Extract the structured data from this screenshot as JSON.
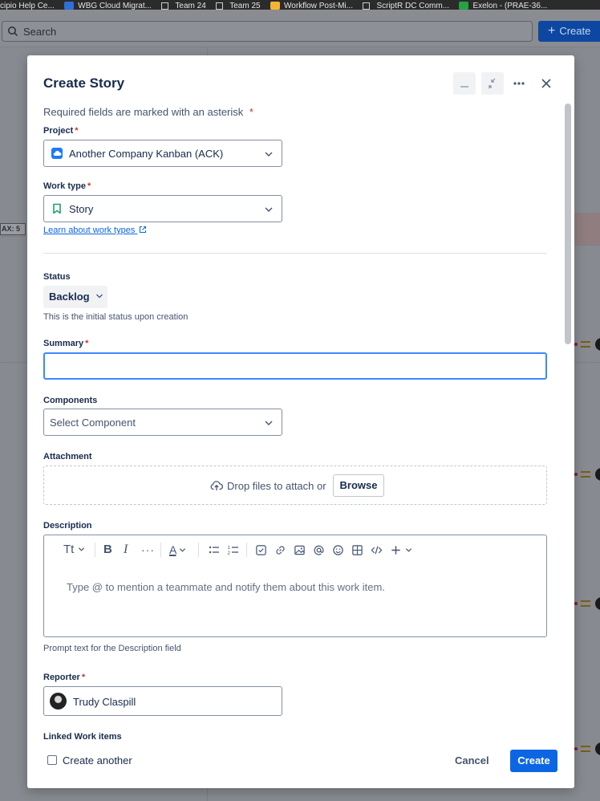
{
  "bookmarks": [
    {
      "label": "cipio Help Ce...",
      "icon": "none"
    },
    {
      "label": "WBG Cloud Migrat...",
      "icon": "favicon"
    },
    {
      "label": "Team 24",
      "icon": "folder"
    },
    {
      "label": "Team 25",
      "icon": "folder"
    },
    {
      "label": "Workflow Post-Mi...",
      "icon": "favicon"
    },
    {
      "label": "ScriptR DC Comm...",
      "icon": "folder"
    },
    {
      "label": "Exelon - (PRAE-36...",
      "icon": "favicon"
    }
  ],
  "topbar": {
    "search_placeholder": "Search",
    "create_label": "Create"
  },
  "background": {
    "max_tag": "AX: 5"
  },
  "modal": {
    "title": "Create Story",
    "required_note": "Required fields are marked with an asterisk",
    "asterisk": "*",
    "project": {
      "label": "Project",
      "value": "Another Company Kanban (ACK)"
    },
    "work_type": {
      "label": "Work type",
      "value": "Story",
      "learn_link": "Learn about work types"
    },
    "status": {
      "label": "Status",
      "value": "Backlog",
      "helper": "This is the initial status upon creation"
    },
    "summary": {
      "label": "Summary",
      "value": ""
    },
    "components": {
      "label": "Components",
      "placeholder": "Select Component"
    },
    "attachment": {
      "label": "Attachment",
      "drop_text": "Drop files to attach or",
      "browse_label": "Browse"
    },
    "description": {
      "label": "Description",
      "toolbar": {
        "text_style": "Tt",
        "bold": "B",
        "italic": "I",
        "more": "···",
        "text_color": "A"
      },
      "placeholder": "Type @ to mention a teammate and notify them about this work item.",
      "helper": "Prompt text for the Description field"
    },
    "reporter": {
      "label": "Reporter",
      "value": "Trudy Claspill"
    },
    "linked_items": {
      "label": "Linked Work items"
    },
    "footer": {
      "create_another_label": "Create another",
      "cancel_label": "Cancel",
      "create_label": "Create"
    }
  },
  "colors": {
    "primary": "#0c66e4",
    "required": "#c9372c",
    "focus_border": "#388bff"
  }
}
